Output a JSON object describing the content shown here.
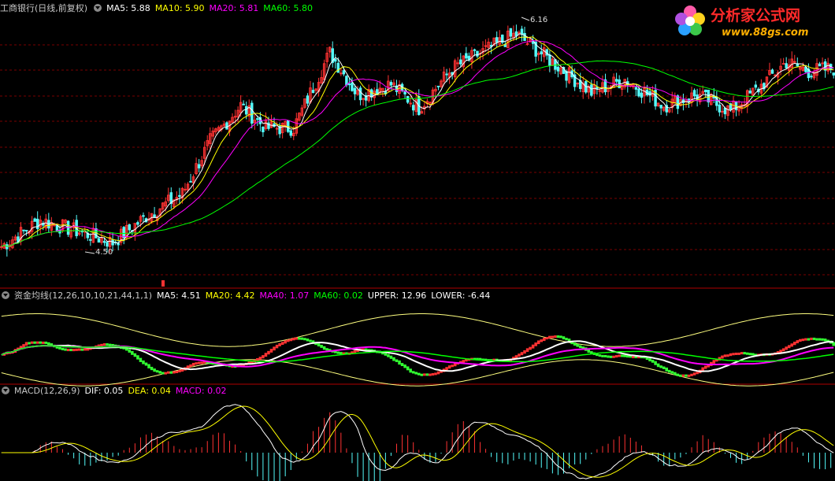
{
  "main_header": {
    "title": "工商银行(日线,前复权)",
    "ma5": "MA5: 5.88",
    "ma10": "MA10: 5.90",
    "ma20": "MA20: 5.81",
    "ma60": "MA60: 5.80"
  },
  "ind_header": {
    "title": "资金均线(12,26,10,10,21,44,1,1)",
    "ma5": "MA5: 4.51",
    "ma20": "MA20: 4.42",
    "ma40": "MA40: 1.07",
    "ma60": "MA60: 0.02",
    "upper": "UPPER: 12.96",
    "lower": "LOWER: -6.44"
  },
  "macd_header": {
    "title": "MACD(12,26,9)",
    "dif": "DIF: 0.05",
    "dea": "DEA: 0.04",
    "macd": "MACD: 0.02"
  },
  "logo": {
    "name": "分析家公式网",
    "url": "www.88gs.com"
  },
  "annotations": {
    "high": "6.16",
    "low": "4.50"
  },
  "colors": {
    "up": "#ff3232",
    "down": "#54fcfc",
    "ma5": "#ffffff",
    "ma10": "#ffff00",
    "ma20": "#ff00ff",
    "ma60": "#00ff00",
    "grid": "#7a0000",
    "separator": "#b00000",
    "dif": "#ffffff",
    "dea": "#ffff00",
    "macd_label": "#ff00ff",
    "band": "#ffff80"
  },
  "chart_data": {
    "type": "candlestick",
    "price_range": [
      4.3,
      6.3
    ],
    "price_keypoints": [
      [
        0,
        4.55
      ],
      [
        14,
        4.75
      ],
      [
        30,
        4.65
      ],
      [
        40,
        4.58
      ],
      [
        52,
        4.78
      ],
      [
        65,
        4.95
      ],
      [
        75,
        5.35
      ],
      [
        86,
        5.62
      ],
      [
        95,
        5.45
      ],
      [
        105,
        5.45
      ],
      [
        118,
        6.02
      ],
      [
        128,
        5.7
      ],
      [
        140,
        5.78
      ],
      [
        150,
        5.6
      ],
      [
        162,
        5.9
      ],
      [
        175,
        6.05
      ],
      [
        185,
        6.16
      ],
      [
        198,
        5.95
      ],
      [
        212,
        5.72
      ],
      [
        224,
        5.82
      ],
      [
        238,
        5.62
      ],
      [
        250,
        5.7
      ],
      [
        262,
        5.58
      ],
      [
        272,
        5.75
      ],
      [
        282,
        5.95
      ],
      [
        290,
        5.88
      ],
      [
        299,
        5.9
      ]
    ],
    "high_label": "6.16",
    "low_label": "4.50",
    "num_bars": 300
  }
}
